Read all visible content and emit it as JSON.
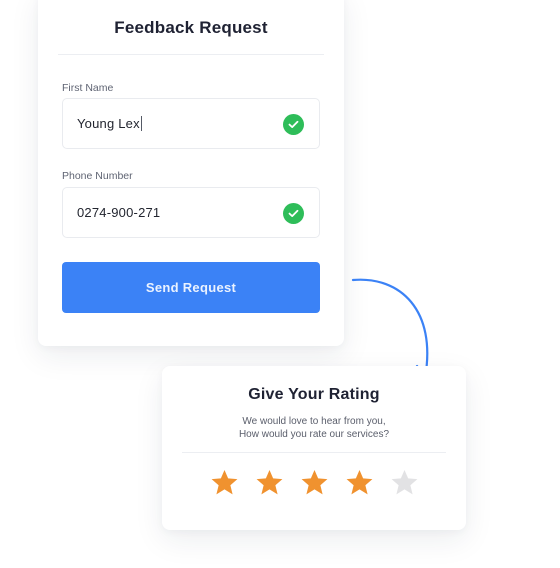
{
  "feedback_form": {
    "title": "Feedback Request",
    "fields": [
      {
        "label": "First Name",
        "value": "Young Lex",
        "valid": true,
        "focused": true
      },
      {
        "label": "Phone Number",
        "value": "0274-900-271",
        "valid": true,
        "focused": false
      }
    ],
    "submit_label": "Send Request"
  },
  "rating_card": {
    "title": "Give Your Rating",
    "subtitle_lines": [
      "We would love to hear from you,",
      "How would you rate our services?"
    ],
    "rating": 4,
    "max_rating": 5
  },
  "colors": {
    "primary": "#3b82f6",
    "success": "#2ebd59",
    "star_filled": "#f0922f",
    "star_empty": "#e2e2e4",
    "title_text": "#1f2233"
  },
  "icons": {
    "field_valid": "check-circle-icon",
    "rating": "star-icon",
    "flow": "curved-arrow-down-icon"
  }
}
